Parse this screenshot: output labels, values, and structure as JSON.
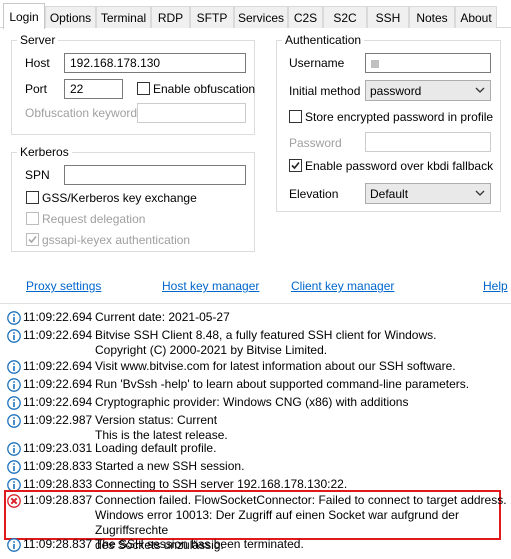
{
  "tabs": [
    {
      "label": "Login",
      "active": true
    },
    {
      "label": "Options"
    },
    {
      "label": "Terminal"
    },
    {
      "label": "RDP"
    },
    {
      "label": "SFTP"
    },
    {
      "label": "Services"
    },
    {
      "label": "C2S"
    },
    {
      "label": "S2C"
    },
    {
      "label": "SSH"
    },
    {
      "label": "Notes"
    },
    {
      "label": "About"
    }
  ],
  "server": {
    "title": "Server",
    "host_label": "Host",
    "host_value": "192.168.178.130",
    "port_label": "Port",
    "port_value": "22",
    "obfuscation_label": "Enable obfuscation",
    "obfuscation_keyword_label": "Obfuscation keyword",
    "obfuscation_keyword_value": ""
  },
  "kerberos": {
    "title": "Kerberos",
    "spn_label": "SPN",
    "spn_value": "",
    "gss_label": "GSS/Kerberos key exchange",
    "delegation_label": "Request delegation",
    "keyex_label": "gssapi-keyex authentication"
  },
  "authentication": {
    "title": "Authentication",
    "username_label": "Username",
    "username_value": "",
    "initial_method_label": "Initial method",
    "initial_method_value": "password",
    "store_password_label": "Store encrypted password in profile",
    "password_label": "Password",
    "kbdi_label": "Enable password over kbdi fallback",
    "elevation_label": "Elevation",
    "elevation_value": "Default"
  },
  "links": {
    "proxy": "Proxy settings",
    "host_key": "Host key manager",
    "client_key": "Client key manager",
    "help": "Help"
  },
  "log": [
    {
      "type": "info",
      "time": "11:09:22.694",
      "message": "Current date: 2021-05-27"
    },
    {
      "type": "info",
      "time": "11:09:22.694",
      "message": "Bitvise SSH Client 8.48, a fully featured SSH client for Windows.\nCopyright (C) 2000-2021 by Bitvise Limited."
    },
    {
      "type": "info",
      "time": "11:09:22.694",
      "message": "Visit www.bitvise.com for latest information about our SSH software."
    },
    {
      "type": "info",
      "time": "11:09:22.694",
      "message": "Run 'BvSsh -help' to learn about supported command-line parameters."
    },
    {
      "type": "info",
      "time": "11:09:22.694",
      "message": "Cryptographic provider: Windows CNG (x86) with additions"
    },
    {
      "type": "info",
      "time": "11:09:22.987",
      "message": "Version status: Current\nThis is the latest release."
    },
    {
      "type": "info",
      "time": "11:09:23.031",
      "message": "Loading default profile."
    },
    {
      "type": "info",
      "time": "11:09:28.833",
      "message": "Started a new SSH session."
    },
    {
      "type": "info",
      "time": "11:09:28.833",
      "message": "Connecting to SSH server 192.168.178.130:22."
    },
    {
      "type": "error",
      "time": "11:09:28.837",
      "message": "Connection failed. FlowSocketConnector: Failed to connect to target address.\nWindows error 10013: Der Zugriff auf einen Socket war aufgrund der Zugriffsrechte\ndes Sockets unzulässig."
    },
    {
      "type": "info",
      "time": "11:09:28.837",
      "message": "The SSH session has been terminated."
    }
  ],
  "colors": {
    "link": "#0066cc",
    "info_icon": "#1e73be",
    "error_icon": "#d9232a",
    "error_highlight": "#e0191c"
  }
}
